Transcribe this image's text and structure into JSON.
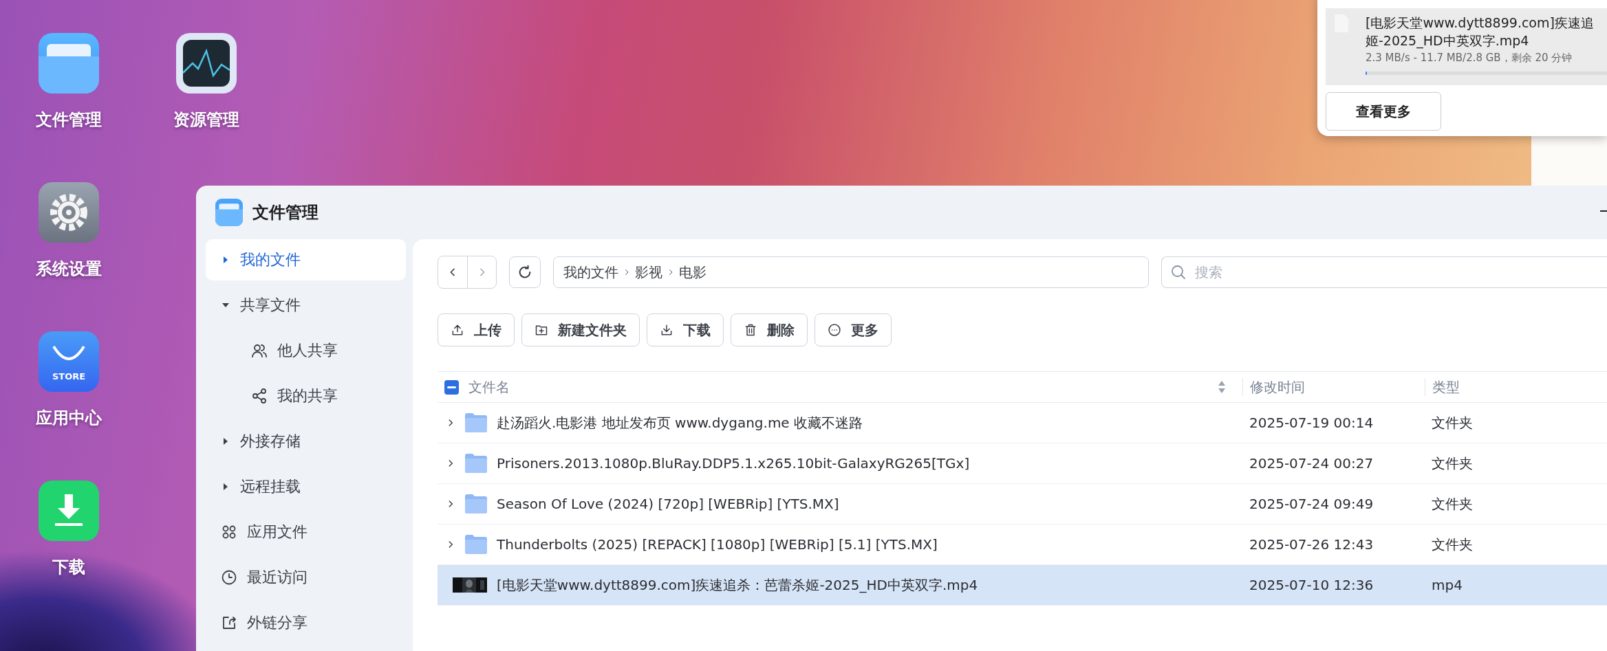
{
  "desktop": {
    "icons": [
      {
        "label": "文件管理",
        "kind": "files"
      },
      {
        "label": "系统设置",
        "kind": "settings"
      },
      {
        "label": "应用中心",
        "kind": "store",
        "badge": "STORE"
      },
      {
        "label": "下载",
        "kind": "download"
      },
      {
        "label": "资源管理",
        "kind": "monitor"
      }
    ]
  },
  "download_popup": {
    "name_line_1": "[电影天堂www.dytt8899.com]疾速追",
    "name_line_2": "姬-2025_HD中英双字.mp4",
    "progress": "2.3 MB/s - 11.7 MB/2.8 GB，剩余 20 分钟",
    "level": 0.004,
    "button": "查看更多"
  },
  "window": {
    "title": "文件管理",
    "sidebar": {
      "items": [
        {
          "label": "我的文件",
          "kind": "tree",
          "expanded": false,
          "selected": true
        },
        {
          "label": "共享文件",
          "kind": "tree",
          "expanded": true,
          "selected": false,
          "children": [
            {
              "label": "他人共享",
              "kind": "people",
              "selected": false
            },
            {
              "label": "我的共享",
              "kind": "share",
              "selected": false
            }
          ]
        },
        {
          "label": "外接存储",
          "kind": "tree",
          "expanded": false,
          "selected": false
        },
        {
          "label": "远程挂载",
          "kind": "tree",
          "expanded": false,
          "selected": false
        },
        {
          "label": "应用文件",
          "kind": "apps",
          "selected": false
        },
        {
          "label": "最近访问",
          "kind": "clock",
          "selected": false
        },
        {
          "label": "外链分享",
          "kind": "link",
          "selected": false
        }
      ]
    },
    "breadcrumb": [
      "我的文件",
      "影视",
      "电影"
    ],
    "search": {
      "placeholder": "搜索"
    },
    "actions": [
      {
        "label": "上传",
        "kind": "upload"
      },
      {
        "label": "新建文件夹",
        "kind": "new-folder"
      },
      {
        "label": "下载",
        "kind": "download"
      },
      {
        "label": "删除",
        "kind": "delete"
      },
      {
        "label": "更多",
        "kind": "more"
      }
    ],
    "table": {
      "select_all_indeterminate": true,
      "columns": [
        "文件名",
        "修改时间",
        "类型"
      ],
      "rows": [
        {
          "name": "赴汤蹈火.电影港 地址发布页 www.dygang.me 收藏不迷路",
          "modified": "2025-07-19 00:14",
          "type": "文件夹",
          "kind": "folder",
          "selected": false
        },
        {
          "name": "Prisoners.2013.1080p.BluRay.DDP5.1.x265.10bit-GalaxyRG265[TGx]",
          "modified": "2025-07-24 00:27",
          "type": "文件夹",
          "kind": "folder",
          "selected": false
        },
        {
          "name": "Season Of Love (2024) [720p] [WEBRip] [YTS.MX]",
          "modified": "2025-07-24 09:49",
          "type": "文件夹",
          "kind": "folder",
          "selected": false
        },
        {
          "name": "Thunderbolts (2025) [REPACK] [1080p] [WEBRip] [5.1] [YTS.MX]",
          "modified": "2025-07-26 12:43",
          "type": "文件夹",
          "kind": "folder",
          "selected": false
        },
        {
          "name": "[电影天堂www.dytt8899.com]疾速追杀：芭蕾杀姬-2025_HD中英双字.mp4",
          "modified": "2025-07-10 12:36",
          "type": "mp4",
          "kind": "video",
          "selected": true
        }
      ]
    }
  }
}
